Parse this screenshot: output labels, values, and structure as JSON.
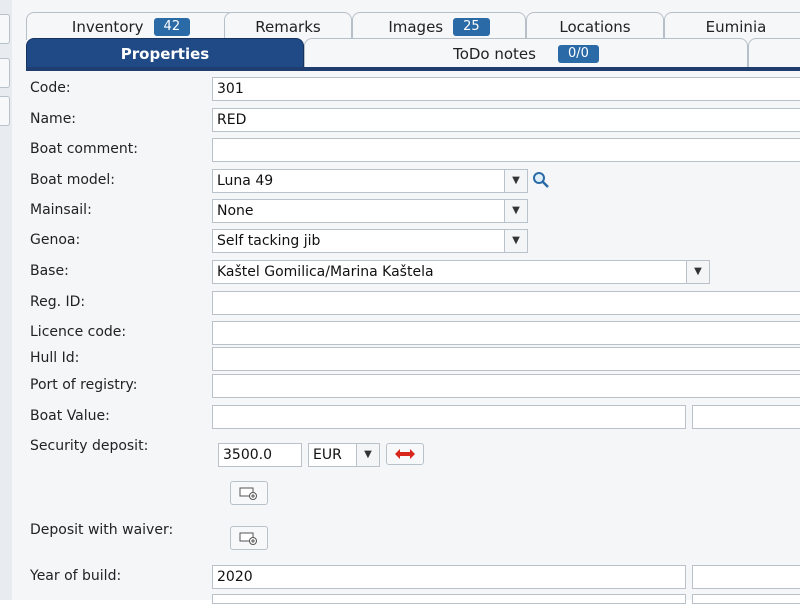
{
  "tabs_row1": [
    {
      "label": "Inventory",
      "badge": "42"
    },
    {
      "label": "Remarks"
    },
    {
      "label": "Images",
      "badge": "25"
    },
    {
      "label": "Locations"
    },
    {
      "label": "Euminia"
    }
  ],
  "tabs_row2": [
    {
      "label": "Properties",
      "active": true
    },
    {
      "label": "ToDo notes",
      "badge": "0/0"
    }
  ],
  "form": {
    "code": {
      "label": "Code:",
      "value": "301"
    },
    "name": {
      "label": "Name:",
      "value": "RED"
    },
    "boat_comment": {
      "label": "Boat comment:",
      "value": ""
    },
    "boat_model": {
      "label": "Boat model:",
      "value": "Luna 49"
    },
    "mainsail": {
      "label": "Mainsail:",
      "value": "None"
    },
    "genoa": {
      "label": "Genoa:",
      "value": "Self tacking jib"
    },
    "base": {
      "label": "Base:",
      "value": "Kaštel Gomilica/Marina Kaštela"
    },
    "reg_id": {
      "label": "Reg. ID:",
      "value": ""
    },
    "licence_code": {
      "label": "Licence code:",
      "value": ""
    },
    "hull_id": {
      "label": "Hull Id:",
      "value": ""
    },
    "port_of_registry": {
      "label": "Port of registry:",
      "value": ""
    },
    "boat_value": {
      "label": "Boat Value:",
      "value": ""
    },
    "security_deposit": {
      "label": "Security deposit:",
      "value": "3500.0",
      "currency": "EUR"
    },
    "deposit_with_waiver": {
      "label": "Deposit with waiver:"
    },
    "year_of_build": {
      "label": "Year of build:",
      "value": "2020"
    }
  },
  "colors": {
    "active_tab": "#1f4a85",
    "badge": "#2a6aa6",
    "accent_line": "#1f3d6e",
    "remove_icon": "#d9261c"
  }
}
